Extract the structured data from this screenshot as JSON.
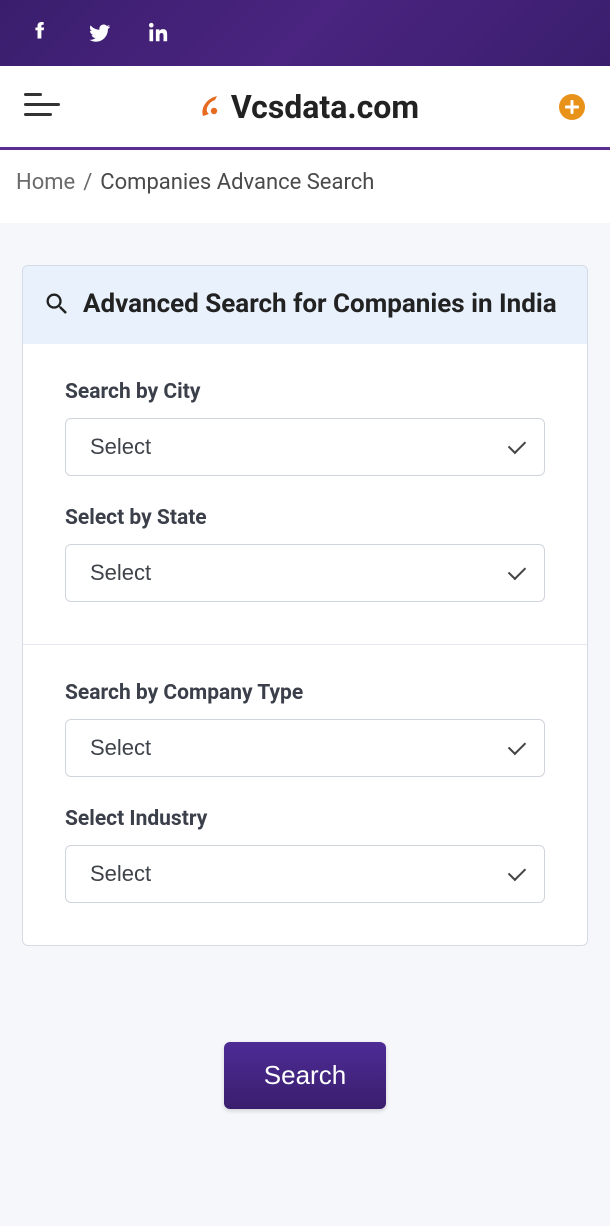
{
  "social": {
    "facebook": "facebook",
    "twitter": "twitter",
    "linkedin": "linkedin"
  },
  "header": {
    "logo_text": "Vcsdata.com"
  },
  "breadcrumb": {
    "home": "Home",
    "separator": "/",
    "current": "Companies Advance Search"
  },
  "card": {
    "title": "Advanced Search for Companies in India",
    "sections": [
      {
        "fields": [
          {
            "label": "Search by City",
            "value": "Select"
          },
          {
            "label": "Select by State",
            "value": "Select"
          }
        ]
      },
      {
        "fields": [
          {
            "label": "Search by Company Type",
            "value": "Select"
          },
          {
            "label": "Select Industry",
            "value": "Select"
          }
        ]
      }
    ]
  },
  "actions": {
    "search_button": "Search"
  },
  "colors": {
    "accent": "#5b2f91",
    "header_bg": "#e8f1fc",
    "plus_icon": "#e99219"
  }
}
